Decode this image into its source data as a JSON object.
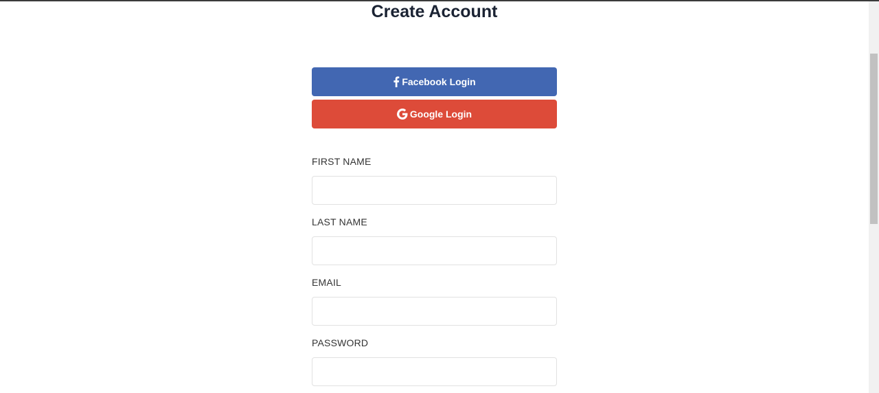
{
  "page": {
    "title": "Create Account"
  },
  "social": {
    "facebook_label": "Facebook Login",
    "google_label": "Google Login",
    "facebook_color": "#4267b2",
    "google_color": "#dd4b39",
    "facebook_icon": "facebook-f-icon",
    "google_icon": "google-g-icon"
  },
  "form": {
    "fields": [
      {
        "label": "FIRST NAME",
        "value": "",
        "placeholder": ""
      },
      {
        "label": "LAST NAME",
        "value": "",
        "placeholder": ""
      },
      {
        "label": "EMAIL",
        "value": "",
        "placeholder": ""
      },
      {
        "label": "PASSWORD",
        "value": "",
        "placeholder": ""
      }
    ]
  }
}
